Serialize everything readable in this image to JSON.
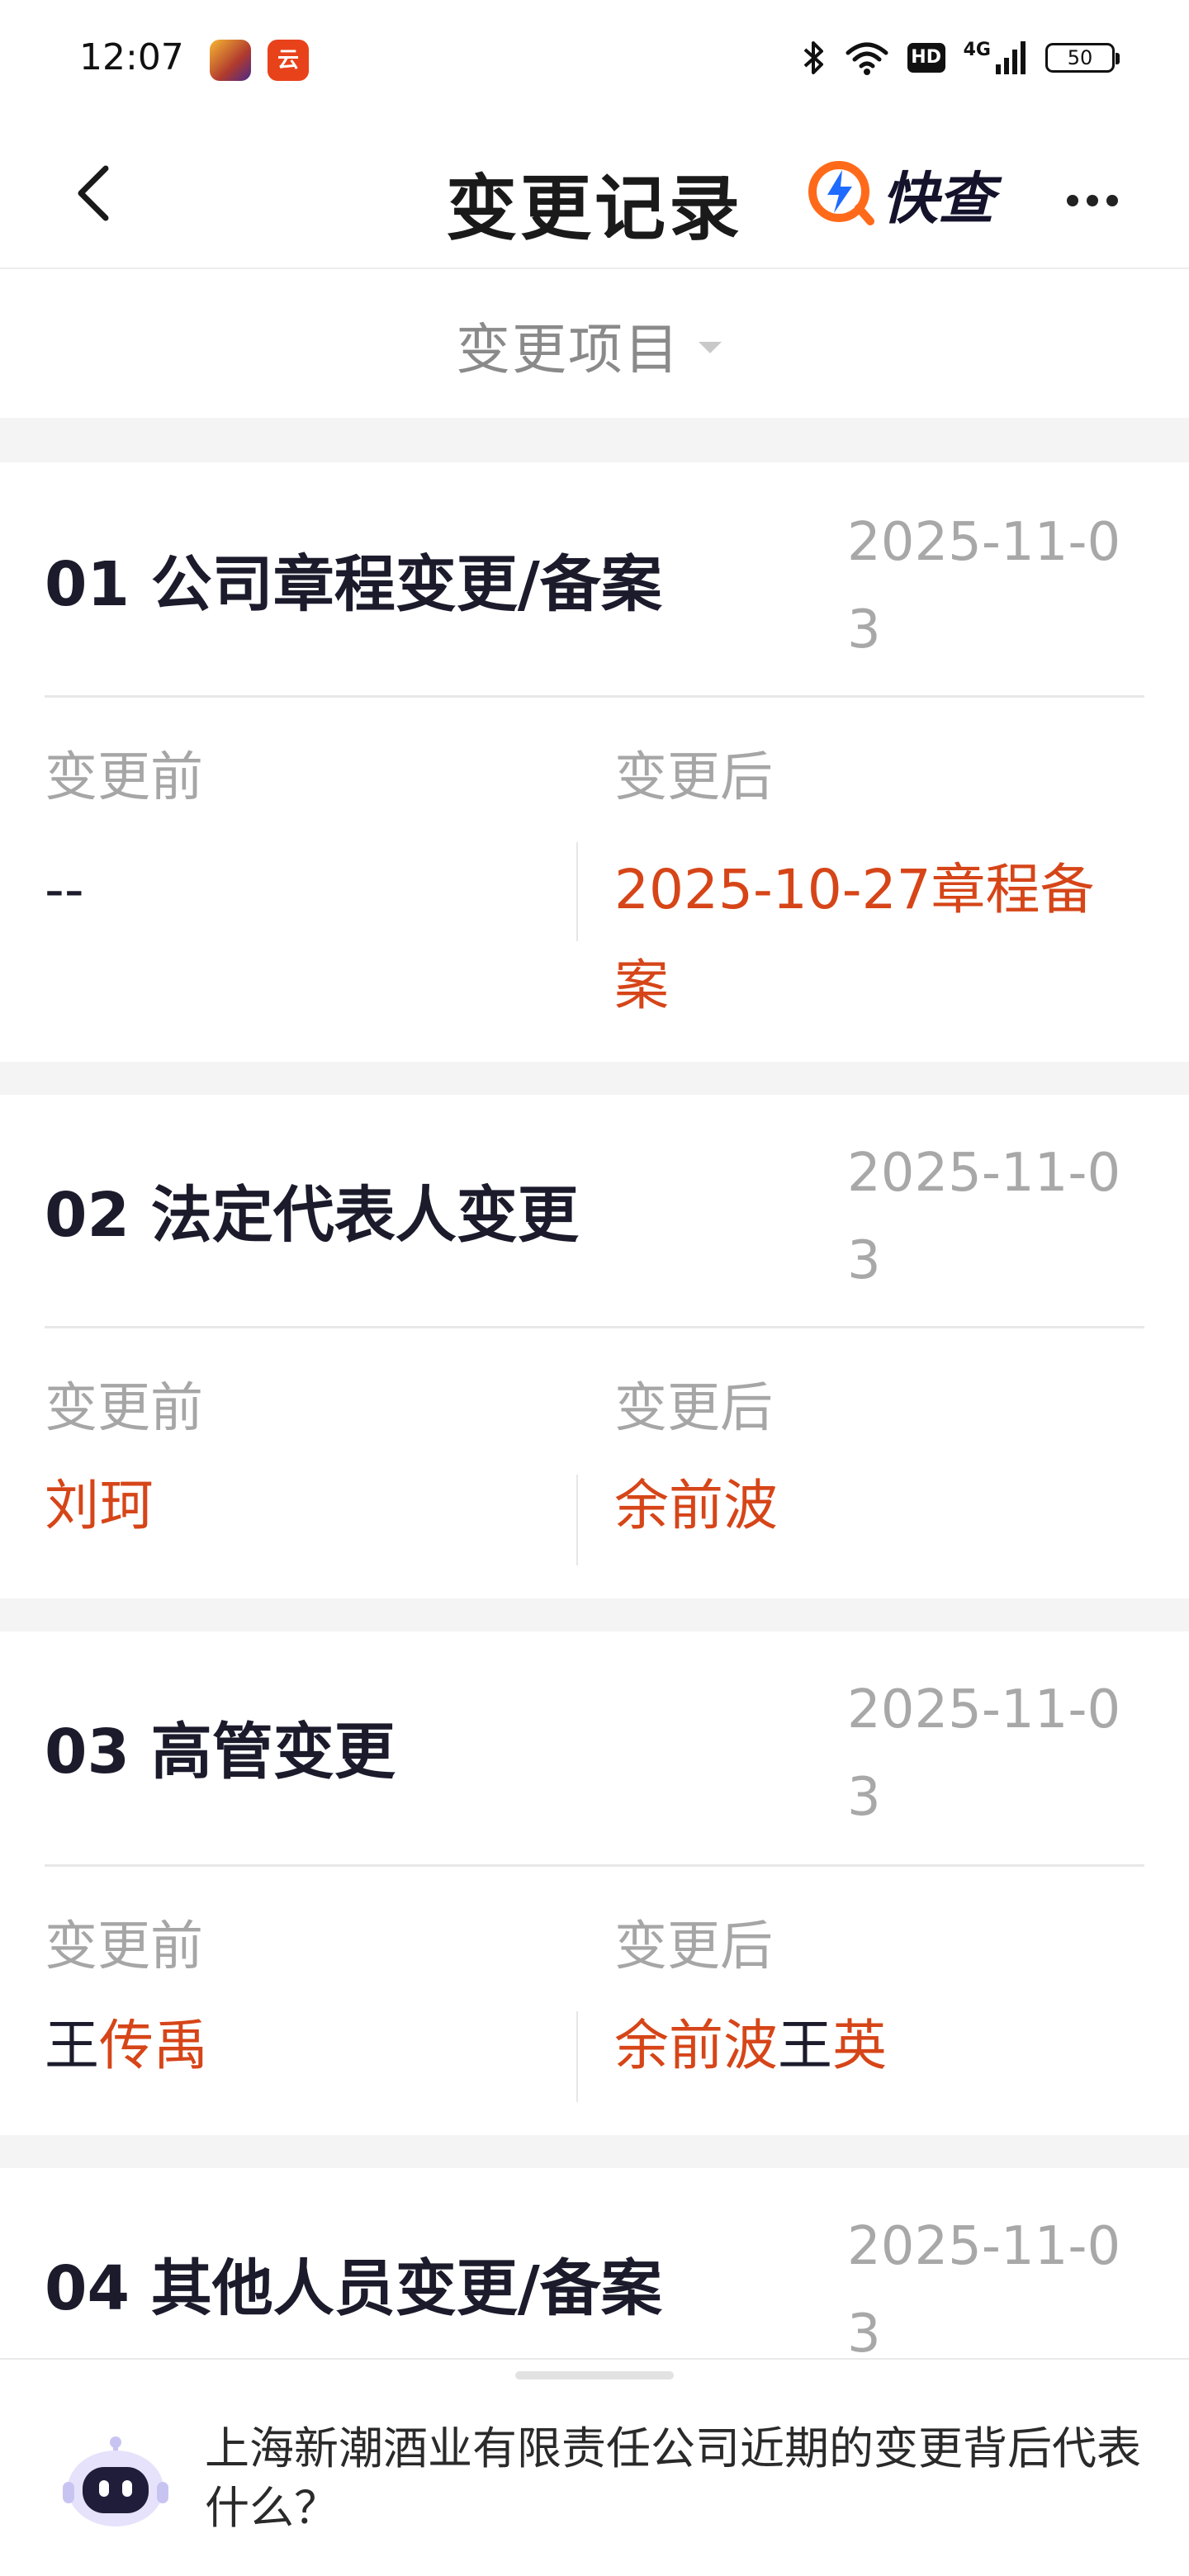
{
  "status_bar": {
    "time": "12:07",
    "app_badge_2": "云",
    "hd_label": "HD",
    "network": "4G",
    "battery": "50"
  },
  "nav": {
    "title": "变更记录",
    "brand": "快查"
  },
  "filter": {
    "label": "变更项目"
  },
  "cards": [
    {
      "title": "01 公司章程变更/备案",
      "date": "2025-11-03",
      "before_label": "变更前",
      "after_label": "变更后",
      "before": [
        {
          "text": "--",
          "highlight": false
        }
      ],
      "after": [
        {
          "text": "2025-10-27章程备案",
          "highlight": true
        }
      ]
    },
    {
      "title": "02 法定代表人变更",
      "date": "2025-11-03",
      "before_label": "变更前",
      "after_label": "变更后",
      "before": [
        {
          "text": "刘珂",
          "highlight": true
        }
      ],
      "after": [
        {
          "text": "余前波",
          "highlight": true
        }
      ]
    },
    {
      "title": "03 高管变更",
      "date": "2025-11-03",
      "before_label": "变更前",
      "after_label": "变更后",
      "before": [
        {
          "text": "王",
          "highlight": false
        },
        {
          "text": "传禹",
          "highlight": true
        }
      ],
      "after": [
        {
          "text": "余前波",
          "highlight": true
        },
        {
          "text": "王",
          "highlight": false
        },
        {
          "text": "英",
          "highlight": true
        }
      ]
    },
    {
      "title": "04 其他人员变更/备案",
      "date": "2025-11-03"
    }
  ],
  "assistant": {
    "question": "上海新潮酒业有限责任公司近期的变更背后代表什么？"
  },
  "colors": {
    "highlight": "#d64518",
    "accent": "#ff6a1a",
    "brand_blue": "#1f6bff"
  }
}
